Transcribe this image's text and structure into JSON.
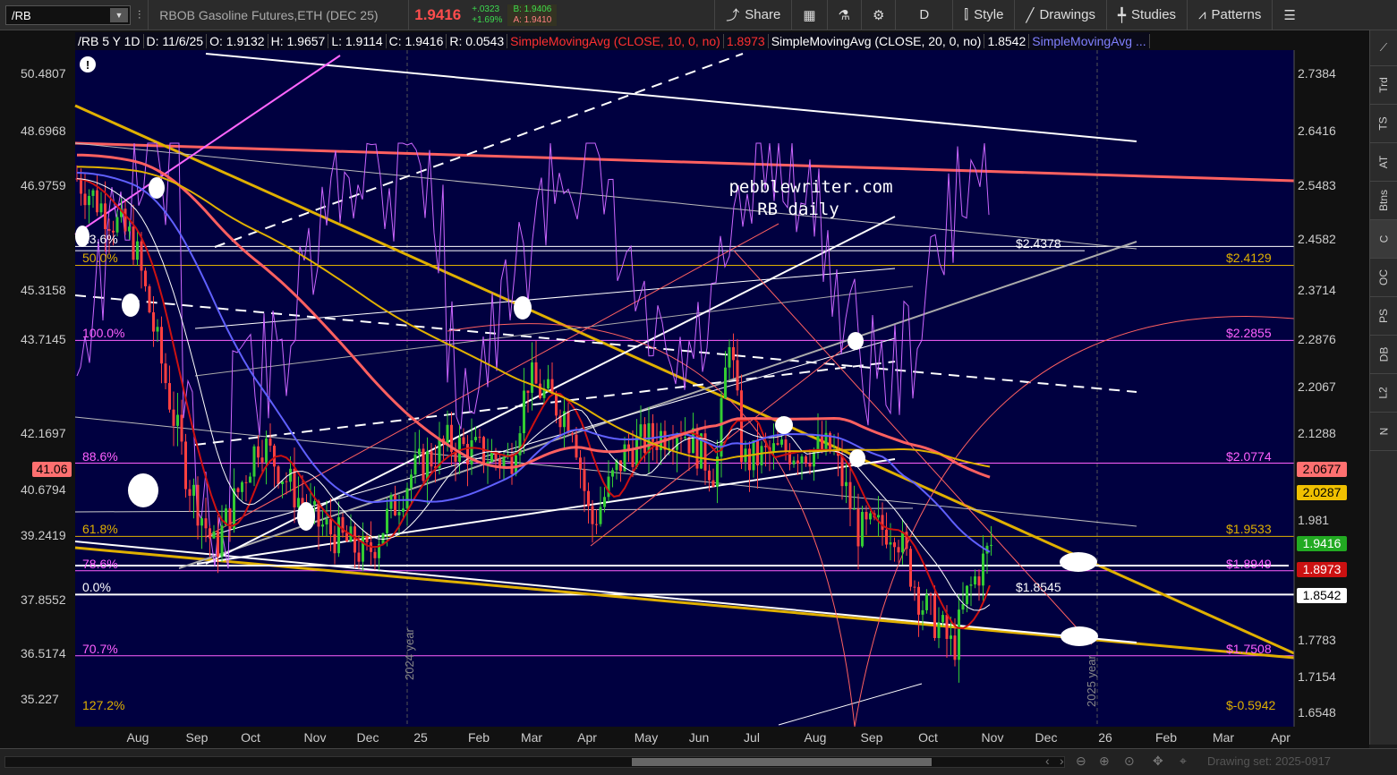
{
  "toolbar": {
    "symbol": "/RB",
    "instrument": "RBOB Gasoline Futures,ETH (DEC 25)",
    "last_price": "1.9416",
    "change": "+.0323",
    "change_pct": "+1.69%",
    "bid": "B: 1.9406",
    "ask": "A: 1.9410",
    "share_label": "Share",
    "timeframe": "D",
    "style_label": "Style",
    "drawings_label": "Drawings",
    "studies_label": "Studies",
    "patterns_label": "Patterns"
  },
  "chart_header": {
    "symbol_period": "/RB 5 Y 1D",
    "date": "D: 11/6/25",
    "open": "O: 1.9132",
    "high": "H: 1.9657",
    "low": "L: 1.9114",
    "close": "C: 1.9416",
    "range": "R: 0.0543",
    "sma10": "SimpleMovingAvg (CLOSE, 10, 0, no)",
    "sma10_val": "1.8973",
    "sma20": "SimpleMovingAvg (CLOSE, 20, 0, no)",
    "sma20_val": "1.8542",
    "sma_more": "SimpleMovingAvg ..."
  },
  "watermark": {
    "line1": "pebblewriter.com",
    "line2": "RB daily"
  },
  "left_axis": [
    {
      "label": "50.4807",
      "v": 2.7384
    },
    {
      "label": "48.6968",
      "v": 2.6416
    },
    {
      "label": "46.9759",
      "v": 2.5483
    },
    {
      "label": "45.3158",
      "v": 2.3714
    },
    {
      "label": "43.7145",
      "v": 2.2876
    },
    {
      "label": "42.1697",
      "v": 2.1288
    },
    {
      "label": "40.6794",
      "v": 2.0333
    },
    {
      "label": "39.2419",
      "v": 1.955
    },
    {
      "label": "37.8552",
      "v": 1.8454
    },
    {
      "label": "36.5174",
      "v": 1.755
    },
    {
      "label": "35.227",
      "v": 1.678
    }
  ],
  "left_marker": "41.06",
  "right_axis": [
    "2.7384",
    "2.6416",
    "2.5483",
    "2.4582",
    "2.3714",
    "2.2876",
    "2.2067",
    "2.1288",
    "1.981",
    "1.7783",
    "1.7154",
    "1.6548"
  ],
  "price_tags": [
    {
      "label": "2.0677",
      "v": 2.0677,
      "bg": "#ff7070",
      "fg": "#000"
    },
    {
      "label": "2.0287",
      "v": 2.0287,
      "bg": "#f0c000",
      "fg": "#000"
    },
    {
      "label": "1.9416",
      "v": 1.9416,
      "bg": "#22aa22",
      "fg": "#fff"
    },
    {
      "label": "1.8973",
      "v": 1.8973,
      "bg": "#cc1111",
      "fg": "#fff"
    },
    {
      "label": "1.8542",
      "v": 1.8542,
      "bg": "#ffffff",
      "fg": "#000"
    }
  ],
  "fib_levels": [
    {
      "pct": "23.6%",
      "price": "",
      "v": 2.445,
      "color": "#ffffff"
    },
    {
      "pct": "50.0%",
      "price": "$2.4129",
      "v": 2.4129,
      "color": "#e0b000"
    },
    {
      "pct": "100.0%",
      "price": "$2.2855",
      "v": 2.2855,
      "color": "#ff60ff"
    },
    {
      "pct": "88.6%",
      "price": "$2.0774",
      "v": 2.0774,
      "color": "#ff60ff"
    },
    {
      "pct": "61.8%",
      "price": "$1.9533",
      "v": 1.9533,
      "color": "#e0b000"
    },
    {
      "pct": "78.6%",
      "price": "$1.8949",
      "v": 1.8949,
      "color": "#ff60ff"
    },
    {
      "pct": "0.0%",
      "price": "",
      "v": 1.8545,
      "color": "#ffffff"
    },
    {
      "pct": "70.7%",
      "price": "$1.7508",
      "v": 1.7508,
      "color": "#ff60ff"
    },
    {
      "pct": "127.2%",
      "price": "$-0.5942",
      "v": 1.6548,
      "color": "#e0b000"
    }
  ],
  "level_texts": [
    {
      "text": "$2.4378",
      "v": 2.4378,
      "color": "#ffffff"
    },
    {
      "text": "$1.8545",
      "v": 1.8545,
      "color": "#ffffff"
    }
  ],
  "x_axis": [
    "Aug",
    "Sep",
    "Oct",
    "Nov",
    "Dec",
    "25",
    "Feb",
    "Mar",
    "Apr",
    "May",
    "Jun",
    "Jul",
    "Aug",
    "Sep",
    "Oct",
    "Nov",
    "Dec",
    "26",
    "Feb",
    "Mar",
    "Apr"
  ],
  "year_markers": [
    "2024 year",
    "2025 year"
  ],
  "right_tabs": [
    "Trd",
    "TS",
    "AT",
    "Btns",
    "C",
    "OC",
    "PS",
    "DB",
    "L2",
    "N"
  ],
  "drawing_set": "Drawing set: 2025-0917",
  "colors": {
    "chart_bg": "#000040",
    "up": "#33cc33",
    "down": "#ff4040",
    "sma10": "#cc1111",
    "sma20": "#ffffff",
    "sma50": "#6060ff",
    "sma100": "#ff6060",
    "sma200": "#e0b000",
    "rsi": "#cc66ff"
  }
}
